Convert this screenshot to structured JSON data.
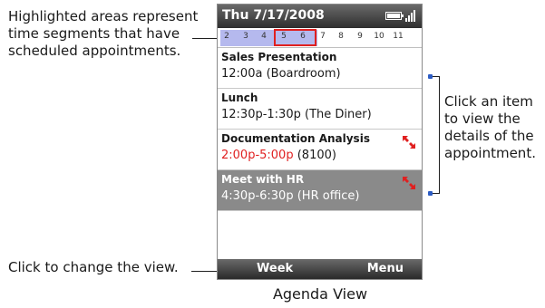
{
  "callouts": {
    "highlight": "Highlighted areas represent time segments that have scheduled appointments.",
    "item": "Click an item to view the details of the appointment.",
    "view": "Click to change the view."
  },
  "caption": "Agenda View",
  "screen": {
    "title": "Thu 7/17/2008",
    "hours": [
      "2",
      "3",
      "4",
      "5",
      "6",
      "7",
      "8",
      "9",
      "10",
      "11"
    ],
    "appointments": [
      {
        "name": "Sales Presentation",
        "time": "12:00a",
        "location": "(Boardroom)",
        "conflict": false,
        "selected": false
      },
      {
        "name": "Lunch",
        "time": "12:30p-1:30p",
        "location": "(The Diner)",
        "conflict": false,
        "selected": false
      },
      {
        "name": "Documentation Analysis",
        "time": "2:00p-5:00p",
        "location": "(8100)",
        "conflict": true,
        "selected": false
      },
      {
        "name": "Meet with HR",
        "time": "4:30p-6:30p",
        "location": "(HR office)",
        "conflict": true,
        "selected": true
      }
    ],
    "softkeys": {
      "left": "Week",
      "right": "Menu"
    }
  },
  "colors": {
    "highlight": "#b5b9ee",
    "conflict_red": "#e02020",
    "selected_bg": "#8a8a8a",
    "callout_marker": "#2c5cc4"
  }
}
